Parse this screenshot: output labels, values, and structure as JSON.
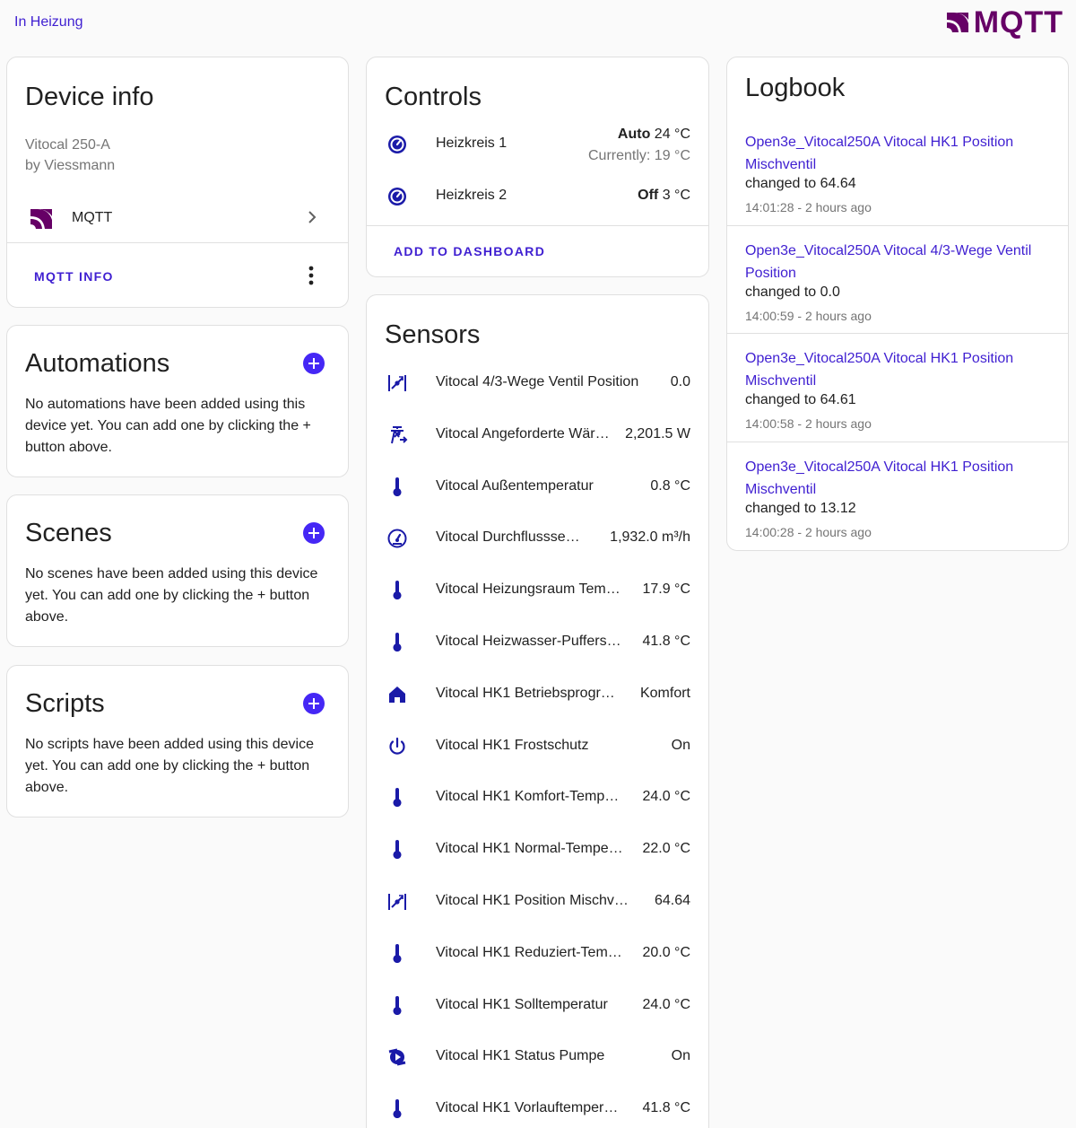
{
  "header": {
    "area_link": "In Heizung",
    "brand_text": "MQTT",
    "brand_color": "#660066"
  },
  "accent_color": "#3f1fd1",
  "device_info": {
    "title": "Device info",
    "model": "Vitocal 250-A",
    "manufacturer": "by Viessmann",
    "integration_label": "MQTT",
    "integration_icon": "mqtt-logo-icon",
    "mqtt_info_label": "MQTT INFO"
  },
  "automations": {
    "title": "Automations",
    "description": "No automations have been added using this device yet. You can add one by clicking the + button above."
  },
  "scenes": {
    "title": "Scenes",
    "description": "No scenes have been added using this device yet. You can add one by clicking the + button above."
  },
  "scripts": {
    "title": "Scripts",
    "description": "No scripts have been added using this device yet. You can add one by clicking the + button above."
  },
  "controls": {
    "title": "Controls",
    "items": [
      {
        "name": "Heizkreis 1",
        "mode": "Auto",
        "target": "24 °C",
        "current": "Currently: 19 °C",
        "icon": "thermostat-icon"
      },
      {
        "name": "Heizkreis 2",
        "mode": "Off",
        "target": "3 °C",
        "icon": "thermostat-icon"
      }
    ],
    "add_to_dashboard": "ADD TO DASHBOARD"
  },
  "sensors": {
    "title": "Sensors",
    "items": [
      {
        "name": "Vitocal 4/3-Wege Ventil Position",
        "value": "0.0",
        "icon": "valve-icon"
      },
      {
        "name": "Vitocal Angeforderte Wär…",
        "value": "2,201.5 W",
        "icon": "transmission-tower-icon"
      },
      {
        "name": "Vitocal Außentemperatur",
        "value": "0.8 °C",
        "icon": "thermometer-icon"
      },
      {
        "name": "Vitocal Durchflussse…",
        "value": "1,932.0 m³/h",
        "icon": "gauge-icon"
      },
      {
        "name": "Vitocal Heizungsraum Tem…",
        "value": "17.9 °C",
        "icon": "thermometer-icon"
      },
      {
        "name": "Vitocal Heizwasser-Puffers…",
        "value": "41.8 °C",
        "icon": "thermometer-icon"
      },
      {
        "name": "Vitocal HK1 Betriebsprogr…",
        "value": "Komfort",
        "icon": "home-icon"
      },
      {
        "name": "Vitocal HK1 Frostschutz",
        "value": "On",
        "icon": "power-icon"
      },
      {
        "name": "Vitocal HK1 Komfort-Temp…",
        "value": "24.0 °C",
        "icon": "thermometer-icon"
      },
      {
        "name": "Vitocal HK1 Normal-Tempe…",
        "value": "22.0 °C",
        "icon": "thermometer-icon"
      },
      {
        "name": "Vitocal HK1 Position Mischv…",
        "value": "64.64",
        "icon": "valve-icon"
      },
      {
        "name": "Vitocal HK1 Reduziert-Tem…",
        "value": "20.0 °C",
        "icon": "thermometer-icon"
      },
      {
        "name": "Vitocal HK1 Solltemperatur",
        "value": "24.0 °C",
        "icon": "thermometer-icon"
      },
      {
        "name": "Vitocal HK1 Status Pumpe",
        "value": "On",
        "icon": "pump-icon"
      },
      {
        "name": "Vitocal HK1 Vorlauftemper…",
        "value": "41.8 °C",
        "icon": "thermometer-icon"
      }
    ]
  },
  "logbook": {
    "title": "Logbook",
    "entries": [
      {
        "entity": "Open3e_Vitocal250A Vitocal HK1 Position Mischventil",
        "message": "changed to 64.64",
        "time": "14:01:28 - 2 hours ago"
      },
      {
        "entity": "Open3e_Vitocal250A Vitocal 4/3-Wege Ventil Position",
        "message": "changed to 0.0",
        "time": "14:00:59 - 2 hours ago"
      },
      {
        "entity": "Open3e_Vitocal250A Vitocal HK1 Position Mischventil",
        "message": "changed to 64.61",
        "time": "14:00:58 - 2 hours ago"
      },
      {
        "entity": "Open3e_Vitocal250A Vitocal HK1 Position Mischventil",
        "message": "changed to 13.12",
        "time": "14:00:28 - 2 hours ago"
      }
    ]
  }
}
